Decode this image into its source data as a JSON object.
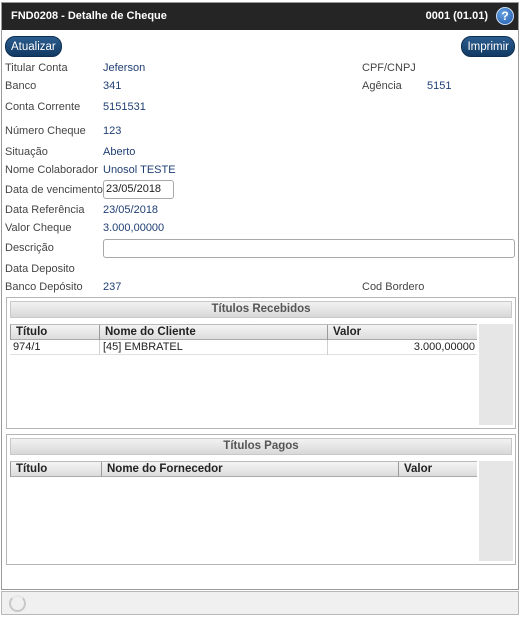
{
  "header": {
    "title": "FND0208 - Detalhe de Cheque",
    "version": "0001 (01.01)",
    "help_symbol": "?"
  },
  "toolbar": {
    "refresh_label": "Atualizar",
    "print_label": "Imprimir"
  },
  "fields": {
    "titular_label": "Titular Conta",
    "titular_value": "Jeferson",
    "cpf_label": "CPF/CNPJ",
    "cpf_value": "",
    "banco_label": "Banco",
    "banco_value": "341",
    "agencia_label": "Agência",
    "agencia_value": "5151",
    "conta_label": "Conta Corrente",
    "conta_value": "5151531",
    "numero_label": "Número Cheque",
    "numero_value": "123",
    "situacao_label": "Situação",
    "situacao_value": "Aberto",
    "colaborador_label": "Nome Colaborador",
    "colaborador_value": "Unosol TESTE",
    "vencimento_label": "Data de vencimento",
    "vencimento_value": "23/05/2018",
    "referencia_label": "Data Referência",
    "referencia_value": "23/05/2018",
    "valor_label": "Valor Cheque",
    "valor_value": "3.000,00000",
    "descricao_label": "Descrição",
    "descricao_value": "",
    "deposito_label": "Data Deposito",
    "deposito_value": "",
    "banco_deposito_label": "Banco Depósito",
    "banco_deposito_value": "237",
    "bordero_label": "Cod Bordero",
    "bordero_value": ""
  },
  "recebidos": {
    "title": "Títulos Recebidos",
    "columns": [
      "Título",
      "Nome do Cliente",
      "Valor"
    ],
    "rows": [
      {
        "titulo": "974/1",
        "cliente": "[45] EMBRATEL",
        "valor": "3.000,00000"
      }
    ]
  },
  "pagos": {
    "title": "Títulos Pagos",
    "columns": [
      "Título",
      "Nome do Fornecedor",
      "Valor"
    ],
    "rows": []
  },
  "colors": {
    "titlebar": "#252525",
    "button": "#1b4470",
    "value_text": "#1f3f73"
  }
}
